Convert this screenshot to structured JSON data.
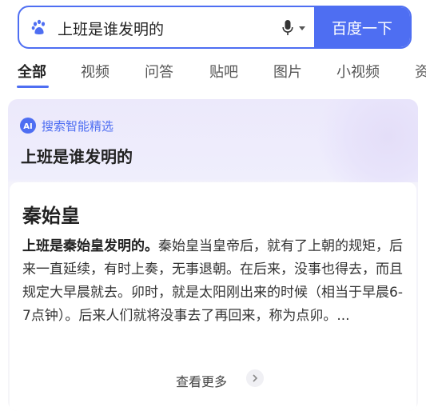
{
  "search": {
    "query": "上班是谁发明的",
    "button_label": "百度一下"
  },
  "tabs": [
    {
      "label": "全部",
      "active": true
    },
    {
      "label": "视频"
    },
    {
      "label": "问答"
    },
    {
      "label": "贴吧"
    },
    {
      "label": "图片"
    },
    {
      "label": "小视频"
    },
    {
      "label": "资"
    }
  ],
  "ai_card": {
    "badge": "AI",
    "label": "搜索智能精选",
    "query": "上班是谁发明的",
    "answer_title": "秦始皇",
    "answer_lead": "上班是秦始皇发明的。",
    "answer_body": "秦始皇当皇帝后，就有了上朝的规矩，后来一直延续，有时上奏，无事退朝。在后来，没事也得去，而且规定大早晨就去。卯时，就是太阳刚出来的时候（相当于早晨6-7点钟）。后来人们就将没事去了再回来，称为点卯。...",
    "more_label": "查看更多"
  },
  "colors": {
    "accent": "#4e6ef2",
    "card_bg": "#ece9fb"
  },
  "icons": {
    "search_logo": "baidu-paw-icon",
    "voice": "microphone-icon",
    "voice_menu": "caret-down-icon",
    "ai": "ai-badge-icon",
    "more": "chevron-right-icon"
  }
}
